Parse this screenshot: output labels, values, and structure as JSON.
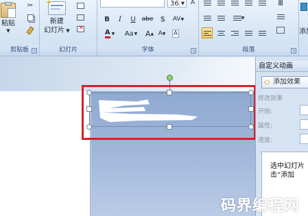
{
  "ribbon": {
    "clipboard": {
      "group_label": "剪贴板",
      "paste_label": "粘贴"
    },
    "slides": {
      "group_label": "幻灯片",
      "new_slide_label": "新建",
      "new_slide_label2": "幻灯片"
    },
    "font": {
      "group_label": "字体",
      "font_size": "36",
      "bold": "B",
      "italic": "I",
      "underline": "U",
      "strike": "abe",
      "shadow": "S",
      "char_spacing": "AV",
      "font_color": "A",
      "change_case": "Aa",
      "grow": "A",
      "shrink": "A",
      "clear": "A"
    },
    "paragraph": {
      "group_label": "段落"
    },
    "right": {
      "add_label": "添加"
    }
  },
  "task_pane": {
    "title": "自定义动画",
    "add_effect_label": "添加效果",
    "modify_label": "修改效果",
    "start_label": "开始:",
    "property_label": "属性:",
    "speed_label": "速度:",
    "hint_line1": "选中幻灯片",
    "hint_line2": "击“添加"
  },
  "watermark": "码界编程网",
  "colors": {
    "highlight": "#d4202a",
    "font_color_red": "#d81e1e",
    "rotate_handle": "#8fd36a"
  }
}
